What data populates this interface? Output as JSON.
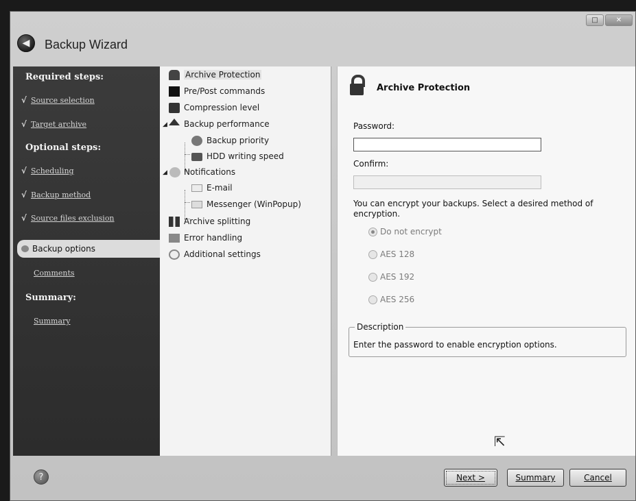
{
  "window": {
    "title": "Backup Wizard",
    "controls": [
      "□",
      "✕"
    ]
  },
  "sidebar": {
    "required_title": "Required steps:",
    "required_steps": [
      "Source selection",
      "Target archive"
    ],
    "optional_title": "Optional steps:",
    "optional_steps": [
      "Scheduling",
      "Backup method",
      "Source files exclusion"
    ],
    "active_step": "Backup options",
    "sub_step": "Comments",
    "summary_title": "Summary:",
    "summary_step": "Summary",
    "check_glyph": "√"
  },
  "tree": {
    "items": [
      "Archive Protection",
      "Pre/Post commands",
      "Compression level",
      "Backup performance",
      "Backup priority",
      "HDD writing speed",
      "Notifications",
      "E-mail",
      "Messenger (WinPopup)",
      "Archive splitting",
      "Error handling",
      "Additional settings"
    ]
  },
  "panel": {
    "title": "Archive Protection",
    "password_label": "Password:",
    "password_value": "",
    "confirm_label": "Confirm:",
    "confirm_value": "",
    "encrypt_note": "You can encrypt your backups. Select a desired method of encryption.",
    "options": [
      "Do not encrypt",
      "AES 128",
      "AES 192",
      "AES 256"
    ],
    "selected_option": "Do not encrypt",
    "description_title": "Description",
    "description_text": "Enter the password to enable encryption options."
  },
  "footer": {
    "next_label": "Next >",
    "summary_label": "Summary",
    "cancel_label": "Cancel"
  }
}
